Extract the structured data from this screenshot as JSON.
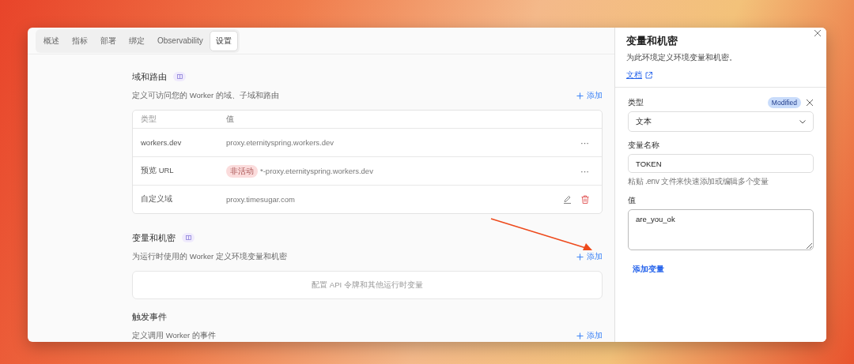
{
  "tabs": [
    {
      "label": "概述",
      "selected": false
    },
    {
      "label": "指标",
      "selected": false
    },
    {
      "label": "部署",
      "selected": false
    },
    {
      "label": "绑定",
      "selected": false
    },
    {
      "label": "Observability",
      "selected": false
    },
    {
      "label": "设置",
      "selected": true
    }
  ],
  "domains": {
    "title": "域和路由",
    "description": "定义可访问您的 Worker 的域、子域和路由",
    "add": "添加",
    "columns": [
      "类型",
      "值"
    ],
    "rows": [
      {
        "kind": "menu",
        "type": "workers.dev",
        "value": "proxy.eternityspring.workers.dev",
        "menu": "···"
      },
      {
        "kind": "menu",
        "type": "预览 URL",
        "badge": "非活动",
        "value": "*-proxy.eternityspring.workers.dev",
        "menu": "···"
      },
      {
        "kind": "edit",
        "type": "自定义域",
        "value": "proxy.timesugar.com"
      }
    ]
  },
  "variables": {
    "title": "变量和机密",
    "description": "为运行时使用的 Worker 定义环境变量和机密",
    "add": "添加",
    "empty": "配置 API 令牌和其他运行时变量"
  },
  "triggers": {
    "title": "触发事件",
    "description": "定义调用 Worker 的事件",
    "add": "添加"
  },
  "panel": {
    "title": "变量和机密",
    "description": "为此环境定义环境变量和机密。",
    "doc_link": "文档",
    "type_label": "类型",
    "status_badge": "Modified",
    "type_value": "文本",
    "name_label": "变量名称",
    "name_value": "TOKEN",
    "hint": "粘贴 .env 文件来快速添加或编辑多个变量",
    "value_label": "值",
    "value_value": "are_you_ok",
    "add_button": "添加变量"
  }
}
